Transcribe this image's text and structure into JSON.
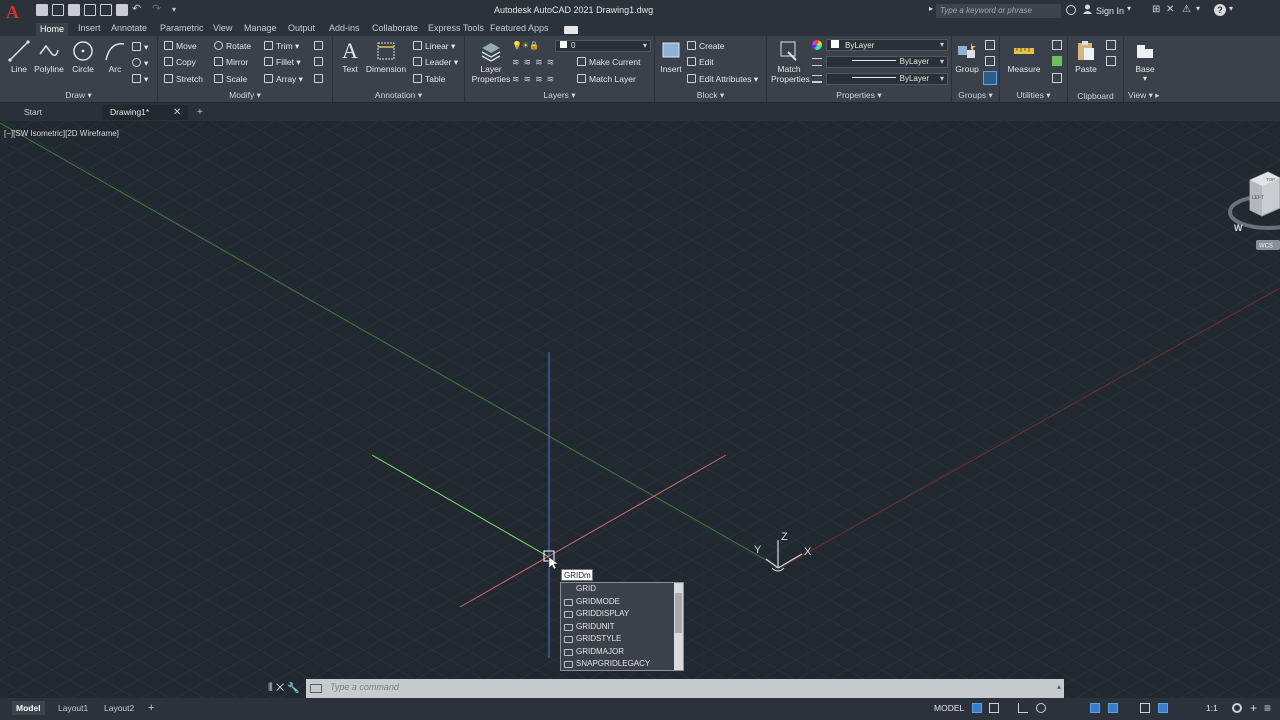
{
  "app": {
    "logo": "A",
    "title": "Autodesk AutoCAD 2021   Drawing1.dwg",
    "search_placeholder": "Type a keyword or phrase",
    "sign_in": "Sign In"
  },
  "ribbon_tabs": [
    "Home",
    "Insert",
    "Annotate",
    "Parametric",
    "View",
    "Manage",
    "Output",
    "Add-ins",
    "Collaborate",
    "Express Tools",
    "Featured Apps"
  ],
  "panels": {
    "draw": {
      "label": "Draw",
      "tools": [
        "Line",
        "Polyline",
        "Circle",
        "Arc"
      ]
    },
    "modify": {
      "label": "Modify",
      "tools": [
        "Move",
        "Rotate",
        "Trim",
        "Copy",
        "Mirror",
        "Fillet",
        "Stretch",
        "Scale",
        "Array"
      ]
    },
    "annotation": {
      "label": "Annotation",
      "big": [
        "Text",
        "Dimension"
      ],
      "tools": [
        "Linear",
        "Leader",
        "Table"
      ]
    },
    "layers": {
      "label": "Layers",
      "big": "Layer Properties",
      "current_layer": "0",
      "tools": [
        "Make Current",
        "Match Layer"
      ]
    },
    "block": {
      "label": "Block",
      "big": "Insert",
      "tools": [
        "Create",
        "Edit",
        "Edit Attributes"
      ]
    },
    "properties": {
      "label": "Properties",
      "big": "Match Properties",
      "color": "ByLayer",
      "linetype": "ByLayer",
      "lineweight": "ByLayer"
    },
    "groups": {
      "label": "Groups",
      "big": "Group"
    },
    "utilities": {
      "label": "Utilities",
      "big": "Measure"
    },
    "clipboard": {
      "label": "Clipboard",
      "big": "Paste"
    },
    "view": {
      "label": "View",
      "big": "Base"
    }
  },
  "file_tabs": [
    "Start",
    "Drawing1*"
  ],
  "viewport_label": "[−][SW Isometric][2D Wireframe]",
  "ucs": {
    "x": "X",
    "y": "Y",
    "z": "Z"
  },
  "viewcube": {
    "face": "LEFT",
    "top": "TOP",
    "compass": "W",
    "wcs": "WCS"
  },
  "command": {
    "typed": "GRIDm",
    "suggestions": [
      "GRID",
      "GRIDMODE",
      "GRIDDISPLAY",
      "GRIDUNIT",
      "GRIDSTYLE",
      "GRIDMAJOR",
      "SNAPGRIDLEGACY"
    ],
    "placeholder": "Type a command"
  },
  "layout_tabs": [
    "Model",
    "Layout1",
    "Layout2"
  ],
  "status": {
    "model": "MODEL",
    "scale": "1:1"
  },
  "colors": {
    "x_axis": "#c05050",
    "y_axis": "#6fbf5a",
    "z_axis": "#5a6fd0",
    "accent": "#3a7cc9"
  }
}
